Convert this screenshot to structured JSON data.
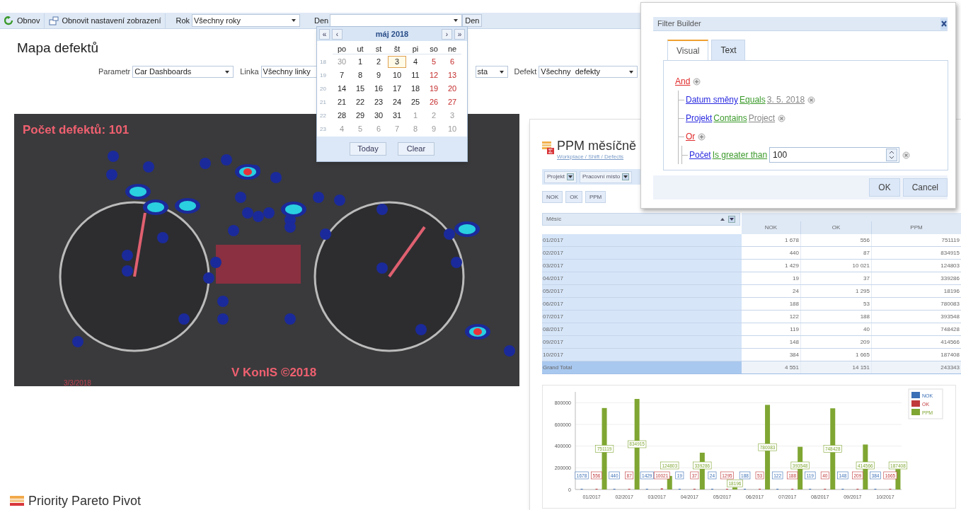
{
  "toolbar": {
    "buttons": [
      {
        "label": "Obnov"
      },
      {
        "label": "Obnovit nastavení zobrazení"
      }
    ],
    "year": {
      "label": "Rok",
      "value": "Všechny roky"
    },
    "day": {
      "label": "Den",
      "button": "Den"
    }
  },
  "page": {
    "title": "Mapa defektů",
    "filters": [
      {
        "label": "Parametr",
        "value": "Car Dashboards"
      },
      {
        "label": "Linka",
        "value": "Všechny linky"
      },
      {
        "value": "sta"
      },
      {
        "label": "Defekt",
        "value": "Všechny  defekty"
      }
    ]
  },
  "calendar": {
    "month": "máj 2018",
    "nav_back": [
      "«",
      "‹"
    ],
    "nav_forward": [
      "›",
      "»"
    ],
    "weekdays": [
      "po",
      "ut",
      "st",
      "št",
      "pi",
      "so",
      "ne"
    ],
    "weeks": [
      {
        "number": "18",
        "days": [
          {
            "label": "30",
            "kind": "other",
            "selected": false
          },
          {
            "label": "1",
            "kind": "weekday",
            "selected": false
          },
          {
            "label": "2",
            "kind": "weekday",
            "selected": false
          },
          {
            "label": "3",
            "kind": "weekday",
            "selected": true
          },
          {
            "label": "4",
            "kind": "weekday",
            "selected": false
          },
          {
            "label": "5",
            "kind": "weekend",
            "selected": false
          },
          {
            "label": "6",
            "kind": "weekend",
            "selected": false
          }
        ]
      },
      {
        "number": "19",
        "days": [
          {
            "label": "7",
            "kind": "weekday",
            "selected": false
          },
          {
            "label": "8",
            "kind": "weekday",
            "selected": false
          },
          {
            "label": "9",
            "kind": "weekday",
            "selected": false
          },
          {
            "label": "10",
            "kind": "weekday",
            "selected": false
          },
          {
            "label": "11",
            "kind": "weekday",
            "selected": false
          },
          {
            "label": "12",
            "kind": "weekend",
            "selected": false
          },
          {
            "label": "13",
            "kind": "weekend",
            "selected": false
          }
        ]
      },
      {
        "number": "20",
        "days": [
          {
            "label": "14",
            "kind": "weekday",
            "selected": false
          },
          {
            "label": "15",
            "kind": "weekday",
            "selected": false
          },
          {
            "label": "16",
            "kind": "weekday",
            "selected": false
          },
          {
            "label": "17",
            "kind": "weekday",
            "selected": false
          },
          {
            "label": "18",
            "kind": "weekday",
            "selected": false
          },
          {
            "label": "19",
            "kind": "weekend",
            "selected": false
          },
          {
            "label": "20",
            "kind": "weekend",
            "selected": false
          }
        ]
      },
      {
        "number": "21",
        "days": [
          {
            "label": "21",
            "kind": "weekday",
            "selected": false
          },
          {
            "label": "22",
            "kind": "weekday",
            "selected": false
          },
          {
            "label": "23",
            "kind": "weekday",
            "selected": false
          },
          {
            "label": "24",
            "kind": "weekday",
            "selected": false
          },
          {
            "label": "25",
            "kind": "weekday",
            "selected": false
          },
          {
            "label": "26",
            "kind": "weekend",
            "selected": false
          },
          {
            "label": "27",
            "kind": "weekend",
            "selected": false
          }
        ]
      },
      {
        "number": "22",
        "days": [
          {
            "label": "28",
            "kind": "weekday",
            "selected": false
          },
          {
            "label": "29",
            "kind": "weekday",
            "selected": false
          },
          {
            "label": "30",
            "kind": "weekday",
            "selected": false
          },
          {
            "label": "31",
            "kind": "weekday",
            "selected": false
          },
          {
            "label": "1",
            "kind": "other",
            "selected": false
          },
          {
            "label": "2",
            "kind": "other",
            "selected": false
          },
          {
            "label": "3",
            "kind": "other",
            "selected": false
          }
        ]
      },
      {
        "number": "23",
        "days": [
          {
            "label": "4",
            "kind": "other",
            "selected": false
          },
          {
            "label": "5",
            "kind": "other",
            "selected": false
          },
          {
            "label": "6",
            "kind": "other",
            "selected": false
          },
          {
            "label": "7",
            "kind": "other",
            "selected": false
          },
          {
            "label": "8",
            "kind": "other",
            "selected": false
          },
          {
            "label": "9",
            "kind": "other",
            "selected": false
          },
          {
            "label": "10",
            "kind": "other",
            "selected": false
          }
        ]
      }
    ],
    "buttons": [
      "Today",
      "Clear"
    ]
  },
  "photo_overlay": {
    "count": "Počet defektů: 101",
    "watermark_label": "V KonIS ©2018",
    "date": "3/3/2018"
  },
  "ppm": {
    "title": "PPM měsíčně",
    "breadcrumb": "Workplace / Shift / Defects",
    "field_buttons": [
      "Projekt",
      "Pracovní místo"
    ],
    "data_buttons": [
      "NOK",
      "OK",
      "PPM"
    ],
    "row_header": "Měsíc",
    "columns": [
      "NOK",
      "OK",
      "PPM"
    ],
    "rows": [
      {
        "kind": "row",
        "label": "01/2017",
        "cells": [
          "1 678",
          "556",
          "751119"
        ]
      },
      {
        "kind": "row",
        "label": "02/2017",
        "cells": [
          "440",
          "87",
          "834915"
        ]
      },
      {
        "kind": "row",
        "label": "03/2017",
        "cells": [
          "1 429",
          "10 021",
          "124803"
        ]
      },
      {
        "kind": "row",
        "label": "04/2017",
        "cells": [
          "19",
          "37",
          "339286"
        ]
      },
      {
        "kind": "row",
        "label": "05/2017",
        "cells": [
          "24",
          "1 295",
          "18196"
        ]
      },
      {
        "kind": "row",
        "label": "06/2017",
        "cells": [
          "188",
          "53",
          "780083"
        ]
      },
      {
        "kind": "row",
        "label": "07/2017",
        "cells": [
          "122",
          "188",
          "393548"
        ]
      },
      {
        "kind": "row",
        "label": "08/2017",
        "cells": [
          "119",
          "40",
          "748428"
        ]
      },
      {
        "kind": "row",
        "label": "09/2017",
        "cells": [
          "148",
          "209",
          "414566"
        ]
      },
      {
        "kind": "row",
        "label": "10/2017",
        "cells": [
          "384",
          "1 665",
          "187408"
        ]
      },
      {
        "kind": "total",
        "label": "Grand Total",
        "cells": [
          "4 551",
          "14 151",
          "243343"
        ]
      }
    ],
    "chart_data": {
      "type": "bar",
      "categories": [
        "01/2017",
        "02/2017",
        "03/2017",
        "04/2017",
        "05/2017",
        "06/2017",
        "07/2017",
        "08/2017",
        "09/2017",
        "10/2017"
      ],
      "series": [
        {
          "name": "NOK",
          "color": "#3b6fb6",
          "values": [
            1678,
            440,
            1429,
            19,
            24,
            188,
            122,
            119,
            148,
            384
          ],
          "value_labels": [
            "1678",
            "440",
            "1429",
            "19",
            "24",
            "188",
            "122",
            "119",
            "148",
            "384"
          ]
        },
        {
          "name": "OK",
          "color": "#c0393b",
          "values": [
            556,
            87,
            10021,
            37,
            1295,
            53,
            188,
            40,
            209,
            1665
          ],
          "value_labels": [
            "556",
            "87",
            "10021",
            "37",
            "1295",
            "53",
            "188",
            "40",
            "209",
            "1665"
          ]
        },
        {
          "name": "PPM",
          "color": "#7fa632",
          "values": [
            751119,
            834915,
            124803,
            339286,
            18196,
            780083,
            393548,
            748428,
            414566,
            187408
          ],
          "value_labels": [
            "751119",
            "834915",
            "124803",
            "339286",
            "18196",
            "780083",
            "393548",
            "748428",
            "414566",
            "187408"
          ]
        }
      ],
      "ylim": [
        0,
        900000
      ],
      "yticks": [
        0,
        200000,
        400000,
        600000,
        800000
      ],
      "grid": true,
      "legend": "right"
    }
  },
  "filter_builder": {
    "title": "Filter Builder",
    "tabs": [
      {
        "label": "Visual",
        "selected": true
      },
      {
        "label": "Text",
        "selected": false
      }
    ],
    "tree": {
      "kind": "group",
      "op": "And",
      "children": [
        {
          "kind": "condition",
          "field": "Datum směny",
          "operator": "Equals",
          "value": "3. 5. 2018"
        },
        {
          "kind": "condition",
          "field": "Projekt",
          "operator": "Contains",
          "value": "Project"
        },
        {
          "kind": "group",
          "op": "Or",
          "children": [
            {
              "kind": "condition",
              "field": "Počet",
              "operator": "Is greater than",
              "input": "100"
            }
          ]
        }
      ]
    },
    "buttons": [
      "OK",
      "Cancel"
    ]
  },
  "bottom_title": "Priority Pareto Pivot"
}
